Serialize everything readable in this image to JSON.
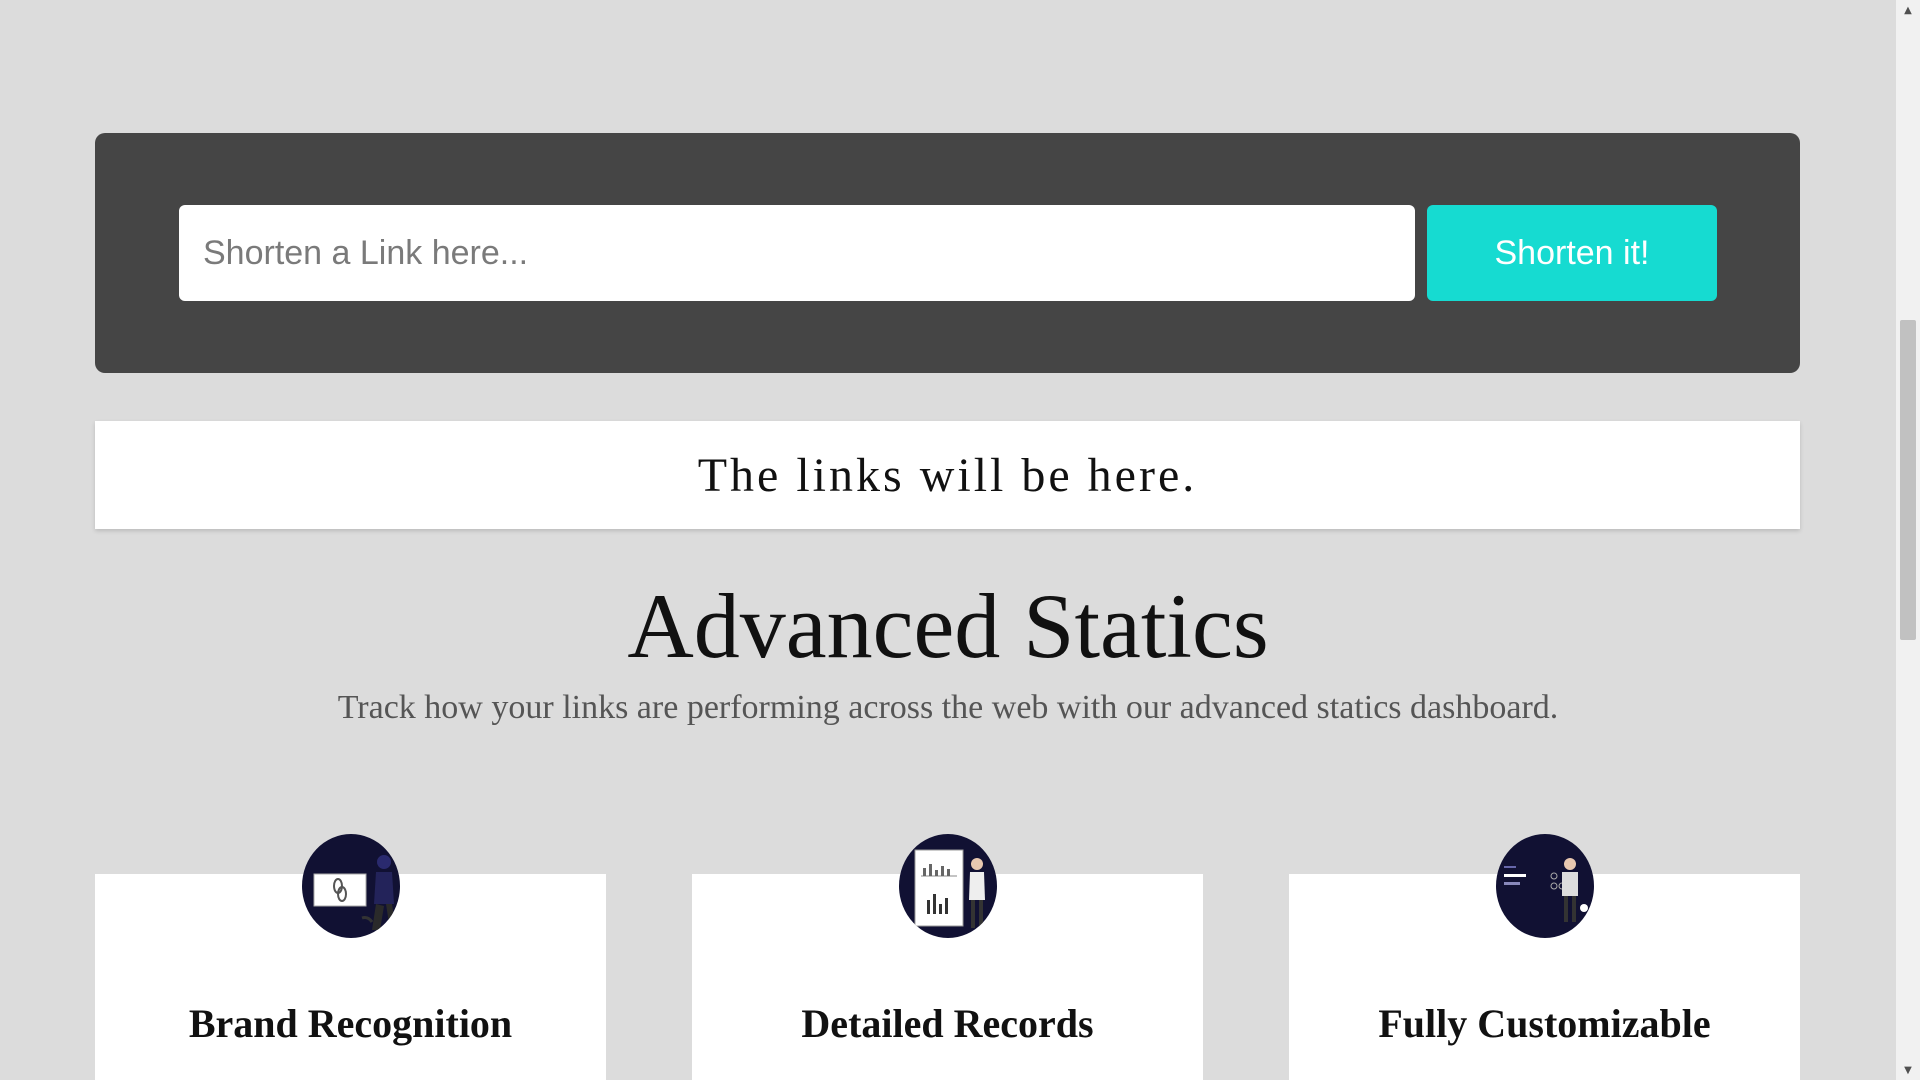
{
  "shortener": {
    "input_placeholder": "Shorten a Link here...",
    "input_value": "",
    "button_label": "Shorten it!",
    "button_color": "#16dbd1"
  },
  "links_panel": {
    "text": "The links will be here."
  },
  "statistics": {
    "title": "Advanced Statics",
    "subtitle": "Track how your links are performing across the web with our advanced statics dashboard.",
    "cards": [
      {
        "icon": "link-illustration-icon",
        "title": "Brand Recognition"
      },
      {
        "icon": "chart-illustration-icon",
        "title": "Detailed Records"
      },
      {
        "icon": "customize-illustration-icon",
        "title": "Fully Customizable"
      }
    ]
  },
  "colors": {
    "background": "#dcdcdc",
    "panel_dark": "#454545",
    "icon_circle": "#111133"
  }
}
